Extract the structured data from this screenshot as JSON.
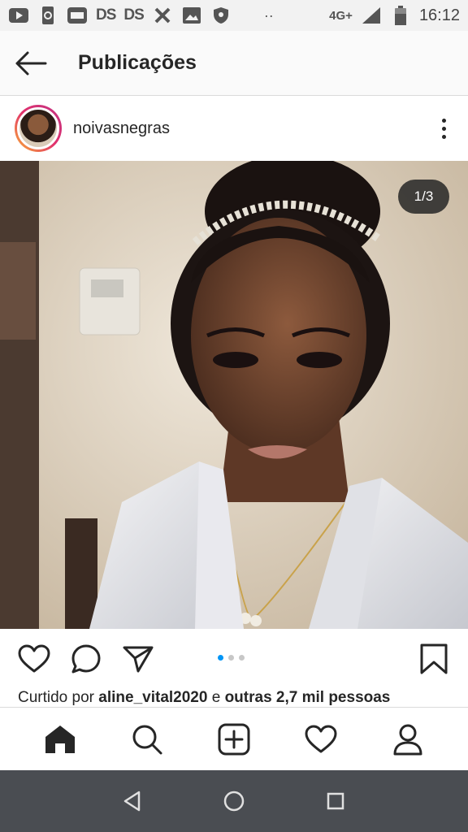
{
  "status_bar": {
    "network": "4G+",
    "time": "16:12",
    "ds_labels": [
      "DS",
      "DS"
    ],
    "more_indicator": "··"
  },
  "app_bar": {
    "title": "Publicações"
  },
  "post": {
    "username": "noivasnegras",
    "image_counter": "1/3",
    "carousel": {
      "total": 3,
      "active": 1
    },
    "likes": {
      "prefix": "Curtido por ",
      "user": "aline_vital2020",
      "middle": " e ",
      "others": "outras 2,7 mil pessoas"
    }
  },
  "icons": {
    "back": "arrow-left-icon",
    "more": "more-vertical-icon",
    "like": "heart-icon",
    "comment": "comment-icon",
    "share": "send-icon",
    "save": "bookmark-icon",
    "home": "home-icon",
    "search": "search-icon",
    "add": "add-post-icon",
    "activity": "heart-icon",
    "profile": "profile-icon"
  },
  "colors": {
    "accent": "#0095f6",
    "text": "#262626",
    "system_nav": "#4a4d52"
  }
}
